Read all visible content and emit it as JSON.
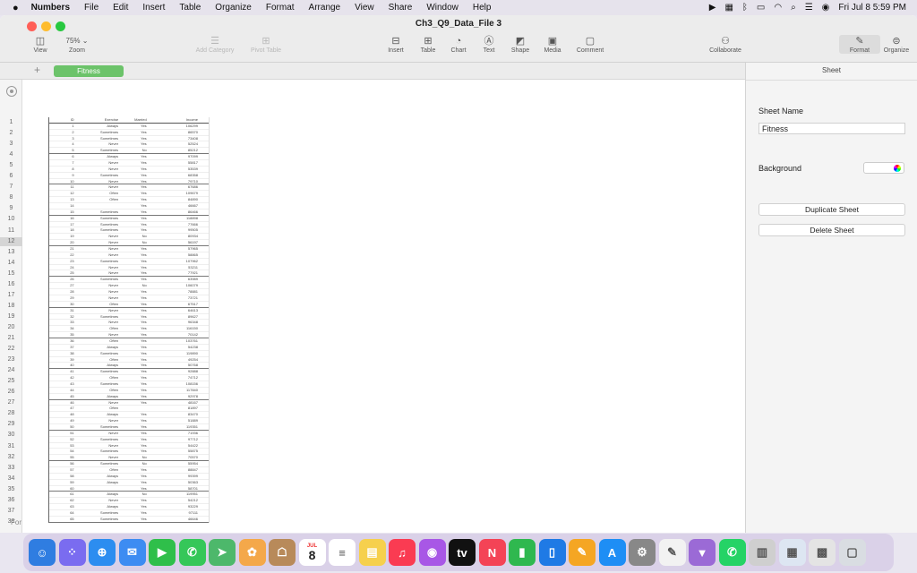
{
  "menubar": {
    "apple": "",
    "app": "Numbers",
    "items": [
      "File",
      "Edit",
      "Insert",
      "Table",
      "Organize",
      "Format",
      "Arrange",
      "View",
      "Share",
      "Window",
      "Help"
    ],
    "datetime": "Fri Jul 8  5:59 PM"
  },
  "window": {
    "title": "Ch3_Q9_Data_File 3",
    "zoom": "75% ⌄"
  },
  "toolbar": {
    "view": "View",
    "zoom": "Zoom",
    "add_category": "Add Category",
    "pivot_table": "Pivot Table",
    "insert": "Insert",
    "table": "Table",
    "chart": "Chart",
    "text": "Text",
    "shape": "Shape",
    "media": "Media",
    "comment": "Comment",
    "collaborate": "Collaborate",
    "format": "Format",
    "organize": "Organize"
  },
  "tabs": {
    "add": "+",
    "sheet": "Fitness"
  },
  "inspector": {
    "header": "Sheet",
    "sheet_name_label": "Sheet Name",
    "sheet_name_value": "Fitness",
    "background_label": "Background",
    "duplicate": "Duplicate Sheet",
    "delete": "Delete Sheet"
  },
  "row_numbers": [
    "1",
    "2",
    "3",
    "4",
    "5",
    "6",
    "7",
    "8",
    "9",
    "10",
    "11",
    "12",
    "13",
    "14",
    "15",
    "16",
    "17",
    "18",
    "19",
    "20",
    "21",
    "22",
    "23",
    "24",
    "25",
    "26",
    "27",
    "28",
    "29",
    "30",
    "31",
    "32",
    "33",
    "34",
    "35",
    "36",
    "37",
    "38"
  ],
  "selected_row": "12",
  "table": {
    "headers": [
      "ID",
      "Exercise",
      "Married",
      "Income"
    ],
    "rows": [
      [
        "1",
        "Always",
        "Yes",
        "106299"
      ],
      [
        "2",
        "Sometimes",
        "Yes",
        "86570"
      ],
      [
        "3",
        "Sometimes",
        "Yes",
        "73408"
      ],
      [
        "4",
        "Never",
        "Yes",
        "52524"
      ],
      [
        "5",
        "Sometimes",
        "No",
        "85212"
      ],
      [
        "6",
        "Always",
        "Yes",
        "97099"
      ],
      [
        "7",
        "Never",
        "Yes",
        "55817"
      ],
      [
        "8",
        "Never",
        "Yes",
        "53539"
      ],
      [
        "9",
        "Sometimes",
        "Yes",
        "68358"
      ],
      [
        "10",
        "Never",
        "Yes",
        "79710"
      ],
      [
        "11",
        "Never",
        "Yes",
        "67686"
      ],
      [
        "12",
        "Often",
        "Yes",
        "109679"
      ],
      [
        "13",
        "Often",
        "Yes",
        "84890"
      ],
      [
        "14",
        "",
        "Yes",
        "46667"
      ],
      [
        "15",
        "Sometimes",
        "Yes",
        "86466"
      ],
      [
        "16",
        "Sometimes",
        "Yes",
        "118898"
      ],
      [
        "17",
        "Sometimes",
        "Yes",
        "77666"
      ],
      [
        "18",
        "Sometimes",
        "Yes",
        "99505"
      ],
      [
        "19",
        "Never",
        "No",
        "80934"
      ],
      [
        "20",
        "Never",
        "No",
        "56197"
      ],
      [
        "21",
        "Never",
        "Yes",
        "57965"
      ],
      [
        "22",
        "Never",
        "Yes",
        "58865"
      ],
      [
        "23",
        "Sometimes",
        "Yes",
        "107962"
      ],
      [
        "24",
        "Never",
        "Yes",
        "53211"
      ],
      [
        "25",
        "Never",
        "Yes",
        "77921"
      ],
      [
        "26",
        "Sometimes",
        "Yes",
        "63989"
      ],
      [
        "27",
        "Never",
        "No",
        "106079"
      ],
      [
        "28",
        "Never",
        "Yes",
        "78881"
      ],
      [
        "29",
        "Never",
        "Yes",
        "73721"
      ],
      [
        "30",
        "Often",
        "Yes",
        "67517"
      ],
      [
        "31",
        "Never",
        "Yes",
        "64613"
      ],
      [
        "32",
        "Sometimes",
        "Yes",
        "89627"
      ],
      [
        "33",
        "Never",
        "Yes",
        "96348"
      ],
      [
        "34",
        "Often",
        "Yes",
        "116150"
      ],
      [
        "35",
        "Never",
        "Yes",
        "70142"
      ],
      [
        "36",
        "Often",
        "Yes",
        "103761"
      ],
      [
        "37",
        "Always",
        "Yes",
        "54238"
      ],
      [
        "38",
        "Sometimes",
        "Yes",
        "119890"
      ],
      [
        "39",
        "Often",
        "Yes",
        "49254"
      ],
      [
        "40",
        "Always",
        "Yes",
        "50768"
      ],
      [
        "41",
        "Sometimes",
        "Yes",
        "92888"
      ],
      [
        "42",
        "Often",
        "Yes",
        "74712"
      ],
      [
        "43",
        "Sometimes",
        "Yes",
        "108156"
      ],
      [
        "44",
        "Often",
        "Yes",
        "117840"
      ],
      [
        "45",
        "Always",
        "Yes",
        "92978"
      ],
      [
        "46",
        "Never",
        "Yes",
        "48167"
      ],
      [
        "47",
        "Often",
        "",
        "81897"
      ],
      [
        "48",
        "Always",
        "Yes",
        "83470"
      ],
      [
        "49",
        "Never",
        "Yes",
        "51889"
      ],
      [
        "50",
        "Sometimes",
        "Yes",
        "119351"
      ],
      [
        "51",
        "Never",
        "Yes",
        "71936"
      ],
      [
        "52",
        "Sometimes",
        "Yes",
        "97712"
      ],
      [
        "53",
        "Never",
        "Yes",
        "54422"
      ],
      [
        "54",
        "Sometimes",
        "Yes",
        "55875"
      ],
      [
        "55",
        "Never",
        "No",
        "70570"
      ],
      [
        "56",
        "Sometimes",
        "No",
        "55954"
      ],
      [
        "57",
        "Often",
        "Yes",
        "88847"
      ],
      [
        "58",
        "Always",
        "Yes",
        "99399"
      ],
      [
        "59",
        "Always",
        "Yes",
        "50363"
      ],
      [
        "60",
        "",
        "Yes",
        "58701"
      ],
      [
        "61",
        "Always",
        "No",
        "119951"
      ],
      [
        "62",
        "Never",
        "Yes",
        "54212"
      ],
      [
        "63",
        "Always",
        "Yes",
        "93229"
      ],
      [
        "64",
        "Sometimes",
        "Yes",
        "97111"
      ],
      [
        "65",
        "Sometimes",
        "Yes",
        "46646"
      ]
    ]
  },
  "footer_hint": "For",
  "dock": [
    "Finder",
    "Launchpad",
    "Safari",
    "Mail",
    "FaceTime",
    "Messages",
    "Maps",
    "Photos",
    "Contacts",
    "Calendar",
    "Reminders",
    "Notes",
    "Music",
    "Podcasts",
    "TV",
    "News",
    "Numbers",
    "Keynote",
    "Pages",
    "App Store",
    "System Preferences",
    "TextEdit",
    "Instruments",
    "WhatsApp",
    "Archive",
    "Preview",
    "Screenshot",
    "Trash"
  ],
  "calendar": {
    "month": "JUL",
    "day": "8"
  }
}
